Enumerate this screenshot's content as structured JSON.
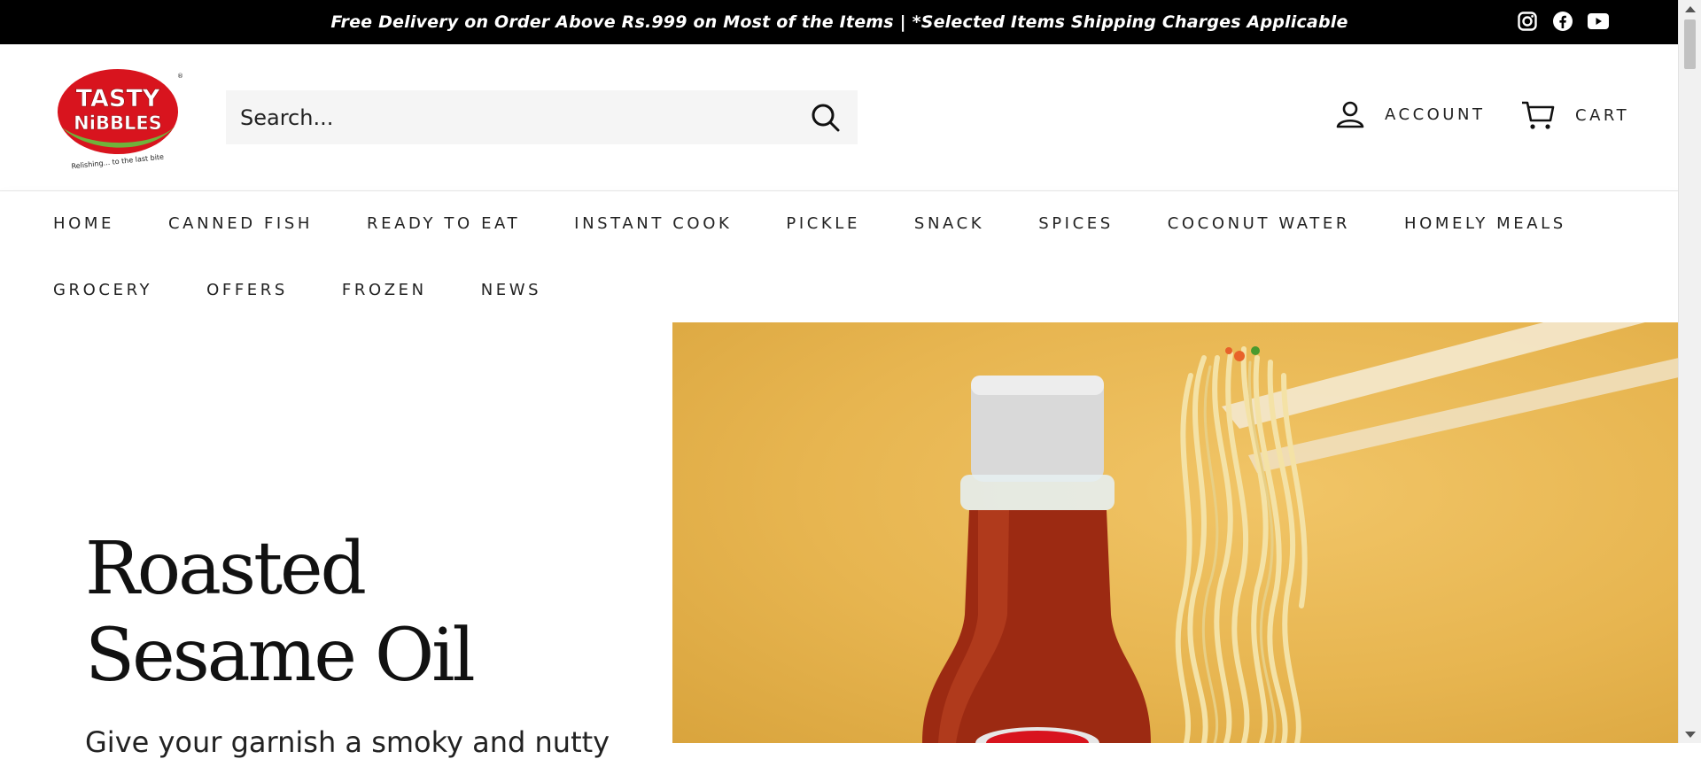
{
  "announcement": {
    "text": "Free Delivery on Order Above Rs.999 on Most of the Items | *Selected Items Shipping Charges Applicable",
    "social_icons": [
      "instagram-icon",
      "facebook-icon",
      "youtube-icon"
    ]
  },
  "header": {
    "logo": {
      "line1": "TASTY",
      "line2": "NiBBLES",
      "tagline": "Relishing... to the last bite"
    },
    "search": {
      "placeholder": "Search..."
    },
    "account_label": "ACCOUNT",
    "cart_label": "CART"
  },
  "nav": {
    "row1": [
      "HOME",
      "CANNED FISH",
      "READY TO EAT",
      "INSTANT COOK",
      "PICKLE",
      "SNACK",
      "SPICES",
      "COCONUT WATER",
      "HOMELY MEALS"
    ],
    "row2": [
      "GROCERY",
      "OFFERS",
      "FROZEN",
      "NEWS"
    ]
  },
  "hero": {
    "title": "Roasted Sesame Oil",
    "subtitle": "Give your garnish a smoky and nutty"
  },
  "colors": {
    "topbar": "#000000",
    "brand_red": "#d8141e",
    "brand_green": "#6fb33b",
    "hero_bg": "#e7b550"
  }
}
